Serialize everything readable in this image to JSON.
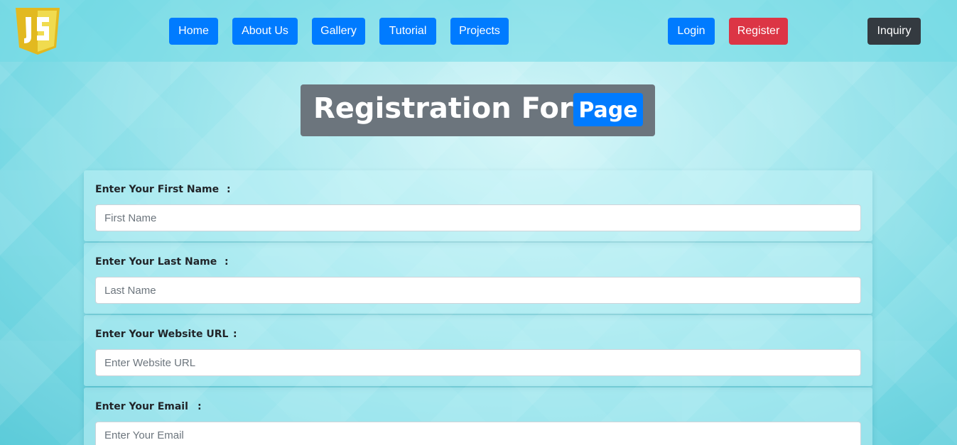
{
  "nav": {
    "logo_text": "JS",
    "items": [
      {
        "label": "Home"
      },
      {
        "label": "About Us"
      },
      {
        "label": "Gallery"
      },
      {
        "label": "Tutorial"
      },
      {
        "label": "Projects"
      }
    ],
    "login": "Login",
    "register": "Register",
    "inquiry": "Inquiry"
  },
  "header": {
    "title": "Registration Form",
    "badge": "Page"
  },
  "form": {
    "fields": [
      {
        "label": "Enter Your First Name",
        "colon": ":",
        "placeholder": "First Name",
        "value": ""
      },
      {
        "label": "Enter Your Last Name",
        "colon": ":",
        "placeholder": "Last Name",
        "value": ""
      },
      {
        "label": "Enter Your Website URL",
        "colon": ":",
        "placeholder": "Enter Website URL",
        "value": ""
      },
      {
        "label": "Enter Your Email",
        "colon": ":",
        "placeholder": "Enter Your Email",
        "value": ""
      }
    ]
  },
  "colors": {
    "primary": "#007bff",
    "danger": "#dc3545",
    "dark": "#343a40",
    "secondary": "#6c757d",
    "logo_yellow": "#f0db4f"
  }
}
